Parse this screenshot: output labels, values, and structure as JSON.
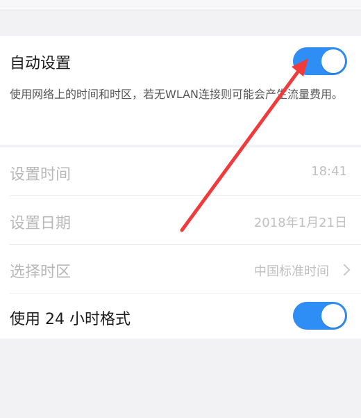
{
  "settings": {
    "auto_setting": {
      "label": "自动设置",
      "enabled": true,
      "description": "使用网络上的时间和时区，若无WLAN连接则可能会产生流量费用。"
    },
    "set_time": {
      "label": "设置时间",
      "value": "18:41"
    },
    "set_date": {
      "label": "设置日期",
      "value": "2018年1月21日"
    },
    "time_zone": {
      "label": "选择时区",
      "value": "中国标准时间"
    },
    "format_24h": {
      "label": "使用 24 小时格式",
      "enabled": true
    }
  },
  "colors": {
    "toggle_on": "#2f8ef5",
    "annotation_arrow": "#ef3b3b"
  },
  "icons": {
    "chevron": "chevron-right-icon"
  }
}
